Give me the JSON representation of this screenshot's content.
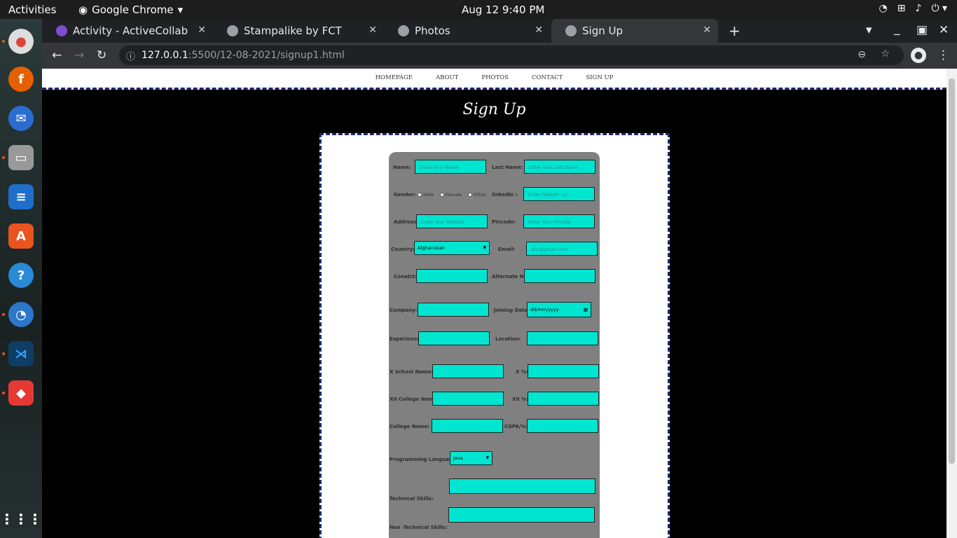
{
  "topbar": {
    "activities": "Activities",
    "app": "Google Chrome",
    "clock": "Aug 12  9:40 PM"
  },
  "tabs": [
    {
      "title": "Activity - ActiveCollab"
    },
    {
      "title": "Stampalike by FCT"
    },
    {
      "title": "Photos"
    },
    {
      "title": "Sign Up"
    }
  ],
  "url": {
    "host": "127.0.0.1",
    "path": ":5500/12-08-2021/signup1.html"
  },
  "nav": [
    "HOMEPAGE",
    "ABOUT",
    "PHOTOS",
    "CONTACT",
    "SIGN UP"
  ],
  "heading": "Sign Up",
  "form": {
    "name_label": "Name:",
    "name_ph": "Enter Your Name",
    "last_label": "Last Name:",
    "last_ph": "Enter Your Last Name",
    "gender_label": "Gender:",
    "male": "Male",
    "female": "Female",
    "other": "Other",
    "linkedin_label": "linkedin :",
    "linkedin_ph": "Enter linkedin url",
    "address_label": "Address:",
    "address_ph": "Enter Your Address",
    "pincode_label": "Pincode:",
    "pincode_ph": "Enter Your Pincode",
    "country_label": "Country:",
    "country_value": "Afghanistan",
    "email_label": "Email:",
    "email_ph": "abc@gmail.com",
    "contact_label": "Conatct:",
    "alt_label": "Alternate No:",
    "company_label": "Company:",
    "joining_label": "Joining Date:",
    "joining_ph": "dd/mm/yyyy",
    "experience_label": "Experience:",
    "location_label": "Location:",
    "xschool_label": "X School Name:",
    "xpct_label": "X %:",
    "xii_label": "XII College Name:",
    "xiipct_label": "XII %:",
    "college_label": "College Name:",
    "cgpa_label": "CGPA/%:",
    "prog_label": "Programming Language:",
    "prog_value": "Java",
    "tech_label": "Technical Skills:",
    "nontech_label": "Non -Technical Skills:"
  }
}
